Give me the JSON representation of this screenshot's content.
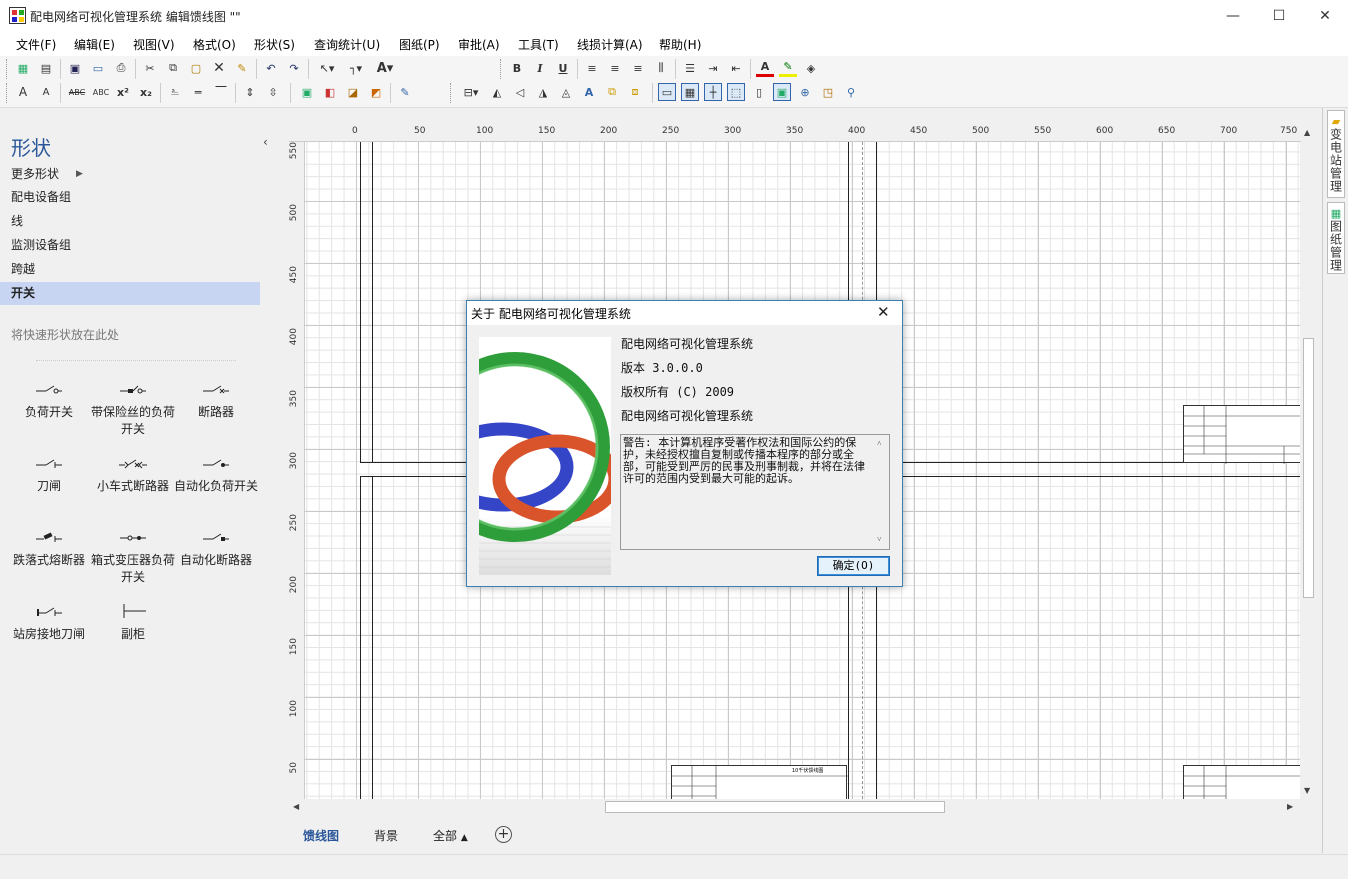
{
  "window": {
    "title": "配电网络可视化管理系统 编辑馈线图 \"\"",
    "minimize": "—",
    "maximize": "☐",
    "close": "✕"
  },
  "menu": [
    "文件(F)",
    "编辑(E)",
    "视图(V)",
    "格式(O)",
    "形状(S)",
    "查询统计(U)",
    "图纸(P)",
    "审批(A)",
    "工具(T)",
    "线损计算(A)",
    "帮助(H)"
  ],
  "toolbar": {
    "bold": "B",
    "italic": "I",
    "underline": "U",
    "font_color_label": "A",
    "grow_font": "A",
    "shrink_font": "A",
    "caps": "ABC",
    "smallcaps": "ABC",
    "superscript": "x²",
    "subscript": "x₂"
  },
  "panel": {
    "title": "形状",
    "collapse": "‹",
    "more": "更多形状",
    "categories": [
      "配电设备组",
      "线",
      "监测设备组",
      "跨越",
      "开关"
    ],
    "selected": "开关",
    "quick_hint": "将快速形状放在此处"
  },
  "stencils": [
    {
      "label": "负荷开关",
      "icon": "load-switch-icon"
    },
    {
      "label": "带保险丝的负荷开关",
      "icon": "fused-load-switch-icon"
    },
    {
      "label": "断路器",
      "icon": "breaker-icon"
    },
    {
      "label": "刀闸",
      "icon": "knife-switch-icon"
    },
    {
      "label": "小车式断路器",
      "icon": "trolley-breaker-icon"
    },
    {
      "label": "自动化负荷开关",
      "icon": "auto-load-switch-icon"
    },
    {
      "label": "跌落式熔断器",
      "icon": "drop-fuse-icon"
    },
    {
      "label": "箱式变压器负荷开关",
      "icon": "box-transformer-switch-icon"
    },
    {
      "label": "自动化断路器",
      "icon": "auto-breaker-icon"
    },
    {
      "label": "站房接地刀闸",
      "icon": "ground-knife-icon"
    },
    {
      "label": "副柜",
      "icon": "sub-cabinet-icon"
    }
  ],
  "ruler": {
    "h": [
      "0",
      "50",
      "100",
      "150",
      "200",
      "250",
      "300",
      "350",
      "400",
      "450",
      "500",
      "550",
      "600",
      "650",
      "700",
      "750"
    ],
    "v": [
      "550",
      "500",
      "450",
      "400",
      "350",
      "300",
      "250",
      "200",
      "150",
      "100",
      "50"
    ]
  },
  "pages": {
    "tabs": [
      "馈线图",
      "背景"
    ],
    "all": "全部",
    "active": "馈线图",
    "add": "+"
  },
  "right_tabs": [
    "变电站管理",
    "图纸管理"
  ],
  "titleblock_text": "10千伏馈线图",
  "dialog": {
    "title": "关于 配电网络可视化管理系统",
    "close": "✕",
    "product": "配电网络可视化管理系统",
    "version": "版本 3.0.0.0",
    "copyright": "版权所有 (C)  2009",
    "company": "配电网络可视化管理系统",
    "warning": "警告: 本计算机程序受著作权法和国际公约的保护，未经授权擅自复制或传播本程序的部分或全部，可能受到严厉的民事及刑事制裁，并将在法律许可的范围内受到最大可能的起诉。",
    "ok": "确定(O)"
  },
  "colors": {
    "accent": "#2b579a",
    "selected_bg": "#c7d4f2",
    "dialog_border": "#3c7fb1",
    "ring_green": "#2e9e3a",
    "ring_blue": "#3545c8",
    "ring_red": "#d9542a"
  }
}
